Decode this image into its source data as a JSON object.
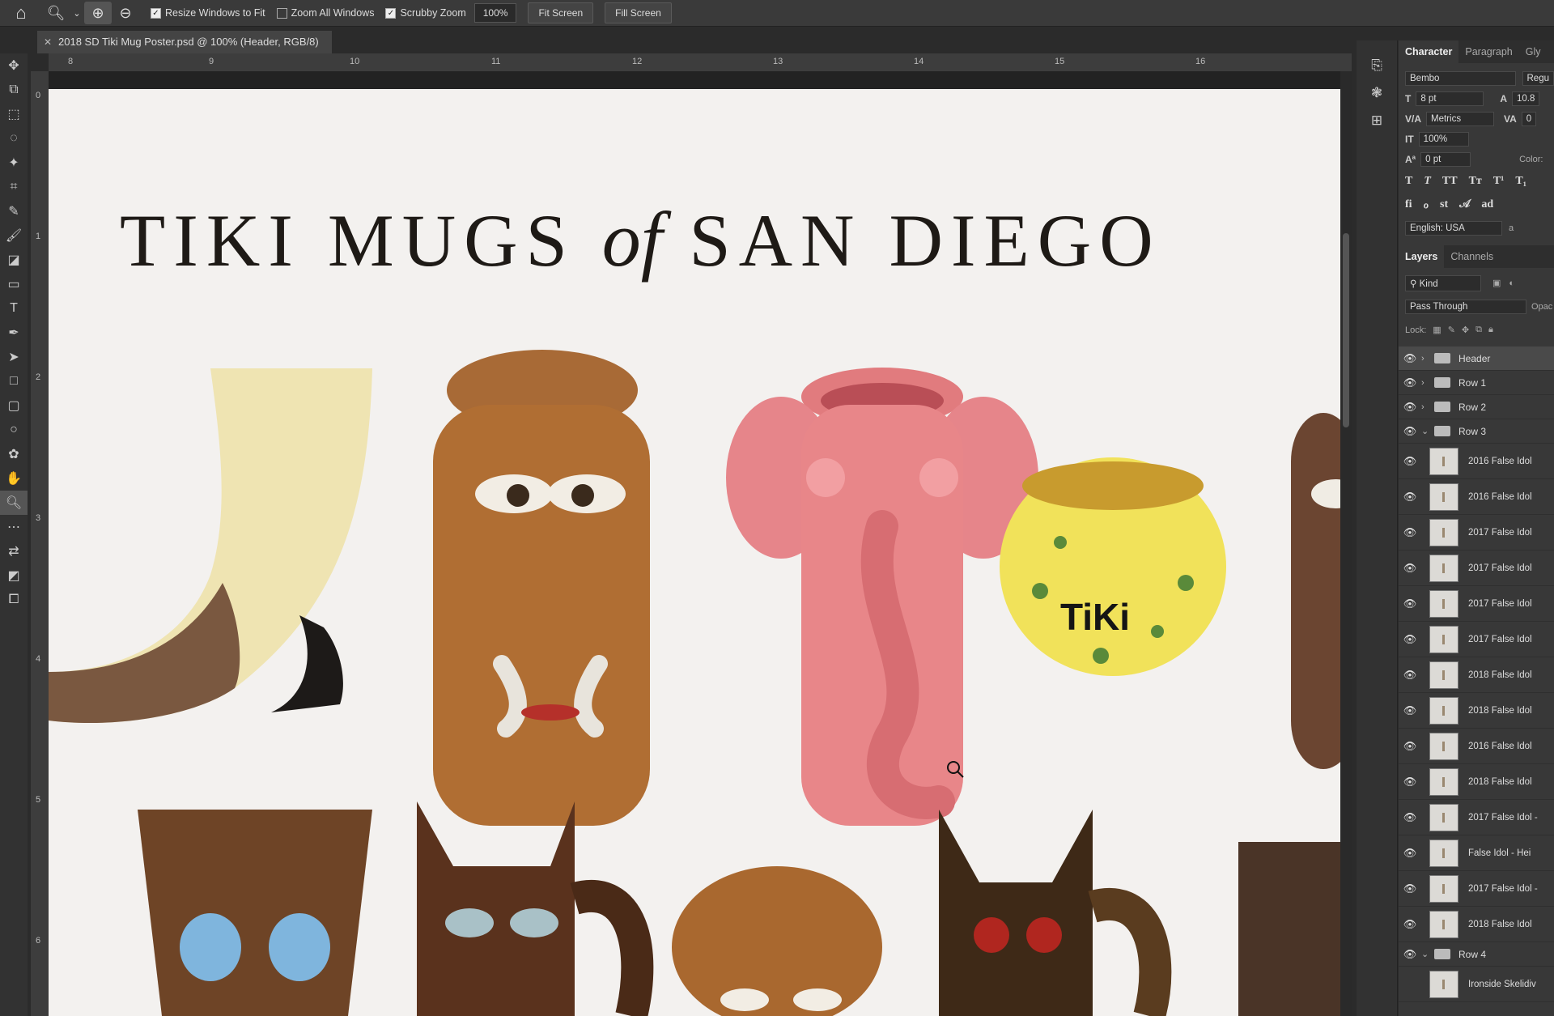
{
  "options_bar": {
    "resize_windows": "Resize Windows to Fit",
    "zoom_all": "Zoom All Windows",
    "scrubby_zoom": "Scrubby Zoom",
    "zoom_value": "100%",
    "fit_screen": "Fit Screen",
    "fill_screen": "Fill Screen"
  },
  "document_tab": {
    "title": "2018 SD Tiki Mug Poster.psd @ 100% (Header, RGB/8)"
  },
  "ruler": {
    "top": [
      "8",
      "9",
      "10",
      "11",
      "12",
      "13",
      "14",
      "15",
      "16"
    ],
    "left": [
      "0",
      "1",
      "2",
      "3",
      "4",
      "5",
      "6"
    ]
  },
  "canvas": {
    "headline_before": "TIKI MUGS",
    "headline_of": "of",
    "headline_after": "SAN DIEGO"
  },
  "character_panel": {
    "tabs": [
      "Character",
      "Paragraph",
      "Gly"
    ],
    "font_family": "Bembo",
    "font_style": "Regu",
    "font_size": "8 pt",
    "leading": "10.8",
    "kerning": "Metrics",
    "tracking": "0",
    "vertical_scale": "100%",
    "baseline_shift": "0 pt",
    "color_label": "Color:",
    "language": "English: USA",
    "aa": "a"
  },
  "layers_panel": {
    "tabs": [
      "Layers",
      "Channels"
    ],
    "filter": "Kind",
    "blend_mode": "Pass Through",
    "opacity_label": "Opac",
    "lock_label": "Lock:",
    "groups_top": [
      "Header",
      "Row 1",
      "Row 2",
      "Row 3"
    ],
    "layers": [
      "2016 False Idol",
      "2016 False Idol",
      "2017 False Idol",
      "2017 False Idol",
      "2017 False Idol",
      "2017 False Idol",
      "2018 False Idol",
      "2018 False Idol",
      "2016 False Idol",
      "2018 False Idol",
      "2017 False Idol -",
      "False Idol - Hei",
      "2017 False Idol -",
      "2018 False Idol"
    ],
    "group_bottom": "Row 4",
    "last_layer": "Ironside Skelidiv"
  }
}
